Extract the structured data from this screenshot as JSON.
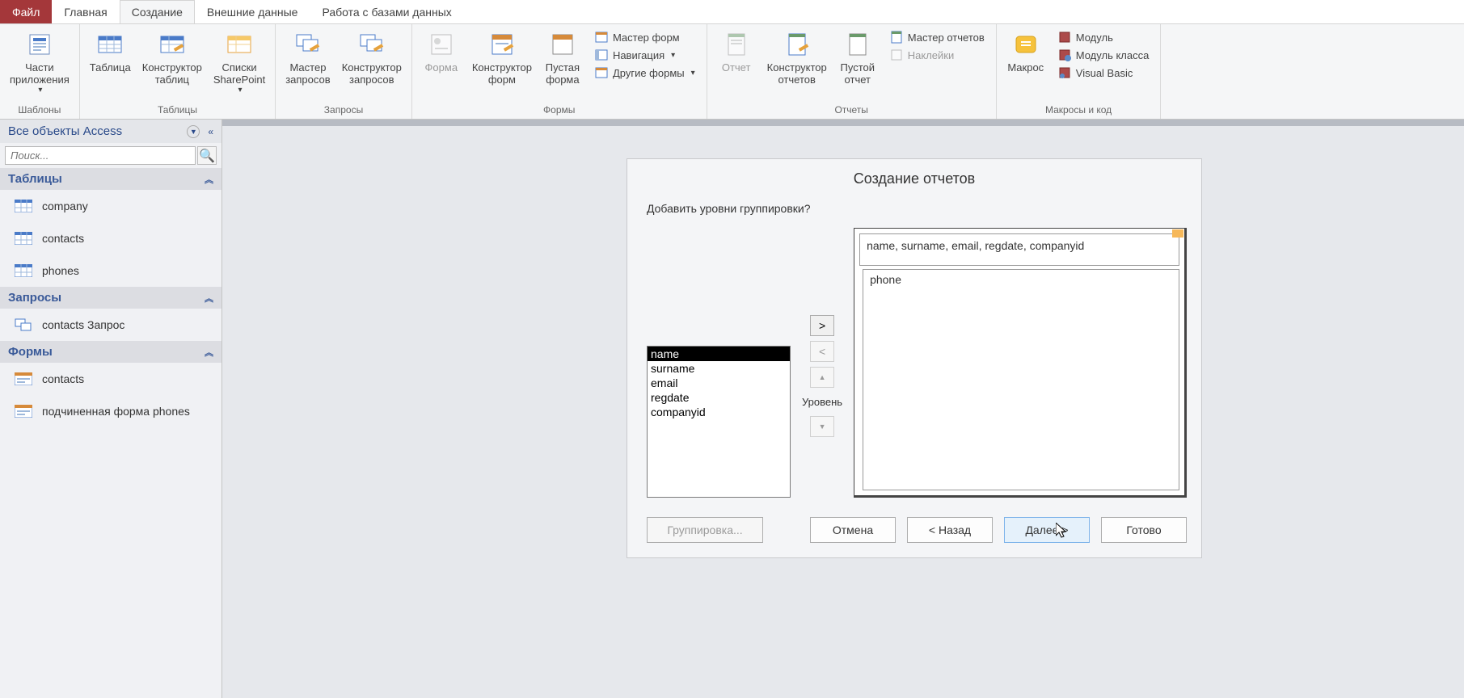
{
  "tabs": {
    "file": "Файл",
    "home": "Главная",
    "create": "Создание",
    "external": "Внешние данные",
    "dbtools": "Работа с базами данных"
  },
  "ribbon": {
    "templates": {
      "parts": "Части\nприложения",
      "group": "Шаблоны"
    },
    "tables": {
      "table": "Таблица",
      "tableDesign": "Конструктор\nтаблиц",
      "sharepoint": "Списки\nSharePoint",
      "group": "Таблицы"
    },
    "queries": {
      "wizard": "Мастер\nзапросов",
      "design": "Конструктор\nзапросов",
      "group": "Запросы"
    },
    "forms": {
      "form": "Форма",
      "formDesign": "Конструктор\nформ",
      "blank": "Пустая\nформа",
      "formWizard": "Мастер форм",
      "nav": "Навигация",
      "other": "Другие формы",
      "group": "Формы"
    },
    "reports": {
      "report": "Отчет",
      "design": "Конструктор\nотчетов",
      "blank": "Пустой\nотчет",
      "wizard": "Мастер отчетов",
      "labels": "Наклейки",
      "group": "Отчеты"
    },
    "macros": {
      "macro": "Макрос",
      "module": "Модуль",
      "classModule": "Модуль класса",
      "vb": "Visual Basic",
      "group": "Макросы и код"
    }
  },
  "nav": {
    "title": "Все объекты Access",
    "searchPlaceholder": "Поиск...",
    "sections": {
      "tables": "Таблицы",
      "queries": "Запросы",
      "forms": "Формы"
    },
    "tables": [
      "company",
      "contacts",
      "phones"
    ],
    "queries": [
      "contacts Запрос"
    ],
    "forms": [
      "contacts",
      "подчиненная форма phones"
    ]
  },
  "wizard": {
    "title": "Создание отчетов",
    "question": "Добавить уровни группировки?",
    "fields": [
      "name",
      "surname",
      "email",
      "regdate",
      "companyid"
    ],
    "selectedField": "name",
    "levelLabel": "Уровень",
    "previewTop": "name, surname, email, regdate, companyid",
    "previewField": "phone",
    "buttons": {
      "grouping": "Группировка...",
      "cancel": "Отмена",
      "back": "< Назад",
      "next": "Далее >",
      "finish": "Готово"
    },
    "moveBtns": {
      "add": ">",
      "remove": "<"
    }
  }
}
